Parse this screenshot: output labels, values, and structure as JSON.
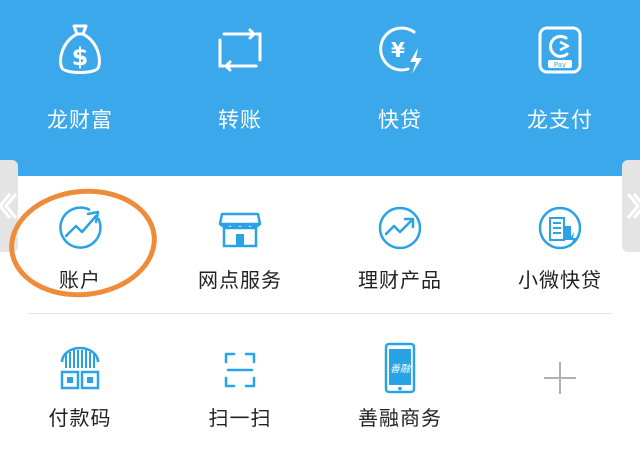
{
  "colors": {
    "banner": "#3aa8ea",
    "icon_blue": "#29a3e6",
    "highlight": "#ee8c3c"
  },
  "top_menu": [
    {
      "label": "龙财富",
      "icon": "money-bag-icon"
    },
    {
      "label": "转账",
      "icon": "transfer-icon"
    },
    {
      "label": "快贷",
      "icon": "quick-loan-icon"
    },
    {
      "label": "龙支付",
      "icon": "long-pay-icon"
    }
  ],
  "grid_menu": [
    {
      "label": "账户",
      "icon": "account-trend-icon"
    },
    {
      "label": "网点服务",
      "icon": "branch-store-icon"
    },
    {
      "label": "理财产品",
      "icon": "wealth-product-icon"
    },
    {
      "label": "小微快贷",
      "icon": "micro-loan-icon"
    },
    {
      "label": "付款码",
      "icon": "payment-code-icon"
    },
    {
      "label": "扫一扫",
      "icon": "scan-icon"
    },
    {
      "label": "善融商务",
      "icon": "shanrong-phone-icon"
    },
    {
      "label": "",
      "icon": "add-icon"
    }
  ],
  "logo_text": {
    "pay": "Pay",
    "shanrong": "善融"
  }
}
